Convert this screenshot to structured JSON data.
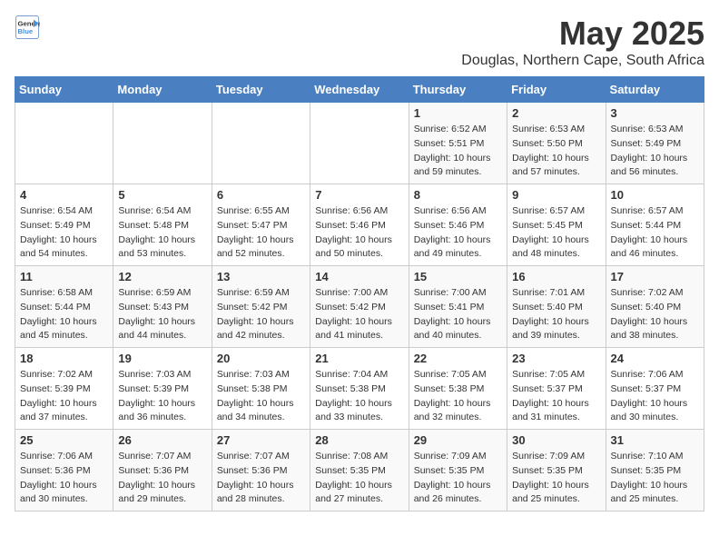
{
  "header": {
    "logo_general": "General",
    "logo_blue": "Blue",
    "title": "May 2025",
    "subtitle": "Douglas, Northern Cape, South Africa"
  },
  "weekdays": [
    "Sunday",
    "Monday",
    "Tuesday",
    "Wednesday",
    "Thursday",
    "Friday",
    "Saturday"
  ],
  "weeks": [
    [
      {
        "day": "",
        "info": ""
      },
      {
        "day": "",
        "info": ""
      },
      {
        "day": "",
        "info": ""
      },
      {
        "day": "",
        "info": ""
      },
      {
        "day": "1",
        "info": "Sunrise: 6:52 AM\nSunset: 5:51 PM\nDaylight: 10 hours and 59 minutes."
      },
      {
        "day": "2",
        "info": "Sunrise: 6:53 AM\nSunset: 5:50 PM\nDaylight: 10 hours and 57 minutes."
      },
      {
        "day": "3",
        "info": "Sunrise: 6:53 AM\nSunset: 5:49 PM\nDaylight: 10 hours and 56 minutes."
      }
    ],
    [
      {
        "day": "4",
        "info": "Sunrise: 6:54 AM\nSunset: 5:49 PM\nDaylight: 10 hours and 54 minutes."
      },
      {
        "day": "5",
        "info": "Sunrise: 6:54 AM\nSunset: 5:48 PM\nDaylight: 10 hours and 53 minutes."
      },
      {
        "day": "6",
        "info": "Sunrise: 6:55 AM\nSunset: 5:47 PM\nDaylight: 10 hours and 52 minutes."
      },
      {
        "day": "7",
        "info": "Sunrise: 6:56 AM\nSunset: 5:46 PM\nDaylight: 10 hours and 50 minutes."
      },
      {
        "day": "8",
        "info": "Sunrise: 6:56 AM\nSunset: 5:46 PM\nDaylight: 10 hours and 49 minutes."
      },
      {
        "day": "9",
        "info": "Sunrise: 6:57 AM\nSunset: 5:45 PM\nDaylight: 10 hours and 48 minutes."
      },
      {
        "day": "10",
        "info": "Sunrise: 6:57 AM\nSunset: 5:44 PM\nDaylight: 10 hours and 46 minutes."
      }
    ],
    [
      {
        "day": "11",
        "info": "Sunrise: 6:58 AM\nSunset: 5:44 PM\nDaylight: 10 hours and 45 minutes."
      },
      {
        "day": "12",
        "info": "Sunrise: 6:59 AM\nSunset: 5:43 PM\nDaylight: 10 hours and 44 minutes."
      },
      {
        "day": "13",
        "info": "Sunrise: 6:59 AM\nSunset: 5:42 PM\nDaylight: 10 hours and 42 minutes."
      },
      {
        "day": "14",
        "info": "Sunrise: 7:00 AM\nSunset: 5:42 PM\nDaylight: 10 hours and 41 minutes."
      },
      {
        "day": "15",
        "info": "Sunrise: 7:00 AM\nSunset: 5:41 PM\nDaylight: 10 hours and 40 minutes."
      },
      {
        "day": "16",
        "info": "Sunrise: 7:01 AM\nSunset: 5:40 PM\nDaylight: 10 hours and 39 minutes."
      },
      {
        "day": "17",
        "info": "Sunrise: 7:02 AM\nSunset: 5:40 PM\nDaylight: 10 hours and 38 minutes."
      }
    ],
    [
      {
        "day": "18",
        "info": "Sunrise: 7:02 AM\nSunset: 5:39 PM\nDaylight: 10 hours and 37 minutes."
      },
      {
        "day": "19",
        "info": "Sunrise: 7:03 AM\nSunset: 5:39 PM\nDaylight: 10 hours and 36 minutes."
      },
      {
        "day": "20",
        "info": "Sunrise: 7:03 AM\nSunset: 5:38 PM\nDaylight: 10 hours and 34 minutes."
      },
      {
        "day": "21",
        "info": "Sunrise: 7:04 AM\nSunset: 5:38 PM\nDaylight: 10 hours and 33 minutes."
      },
      {
        "day": "22",
        "info": "Sunrise: 7:05 AM\nSunset: 5:38 PM\nDaylight: 10 hours and 32 minutes."
      },
      {
        "day": "23",
        "info": "Sunrise: 7:05 AM\nSunset: 5:37 PM\nDaylight: 10 hours and 31 minutes."
      },
      {
        "day": "24",
        "info": "Sunrise: 7:06 AM\nSunset: 5:37 PM\nDaylight: 10 hours and 30 minutes."
      }
    ],
    [
      {
        "day": "25",
        "info": "Sunrise: 7:06 AM\nSunset: 5:36 PM\nDaylight: 10 hours and 30 minutes."
      },
      {
        "day": "26",
        "info": "Sunrise: 7:07 AM\nSunset: 5:36 PM\nDaylight: 10 hours and 29 minutes."
      },
      {
        "day": "27",
        "info": "Sunrise: 7:07 AM\nSunset: 5:36 PM\nDaylight: 10 hours and 28 minutes."
      },
      {
        "day": "28",
        "info": "Sunrise: 7:08 AM\nSunset: 5:35 PM\nDaylight: 10 hours and 27 minutes."
      },
      {
        "day": "29",
        "info": "Sunrise: 7:09 AM\nSunset: 5:35 PM\nDaylight: 10 hours and 26 minutes."
      },
      {
        "day": "30",
        "info": "Sunrise: 7:09 AM\nSunset: 5:35 PM\nDaylight: 10 hours and 25 minutes."
      },
      {
        "day": "31",
        "info": "Sunrise: 7:10 AM\nSunset: 5:35 PM\nDaylight: 10 hours and 25 minutes."
      }
    ]
  ]
}
